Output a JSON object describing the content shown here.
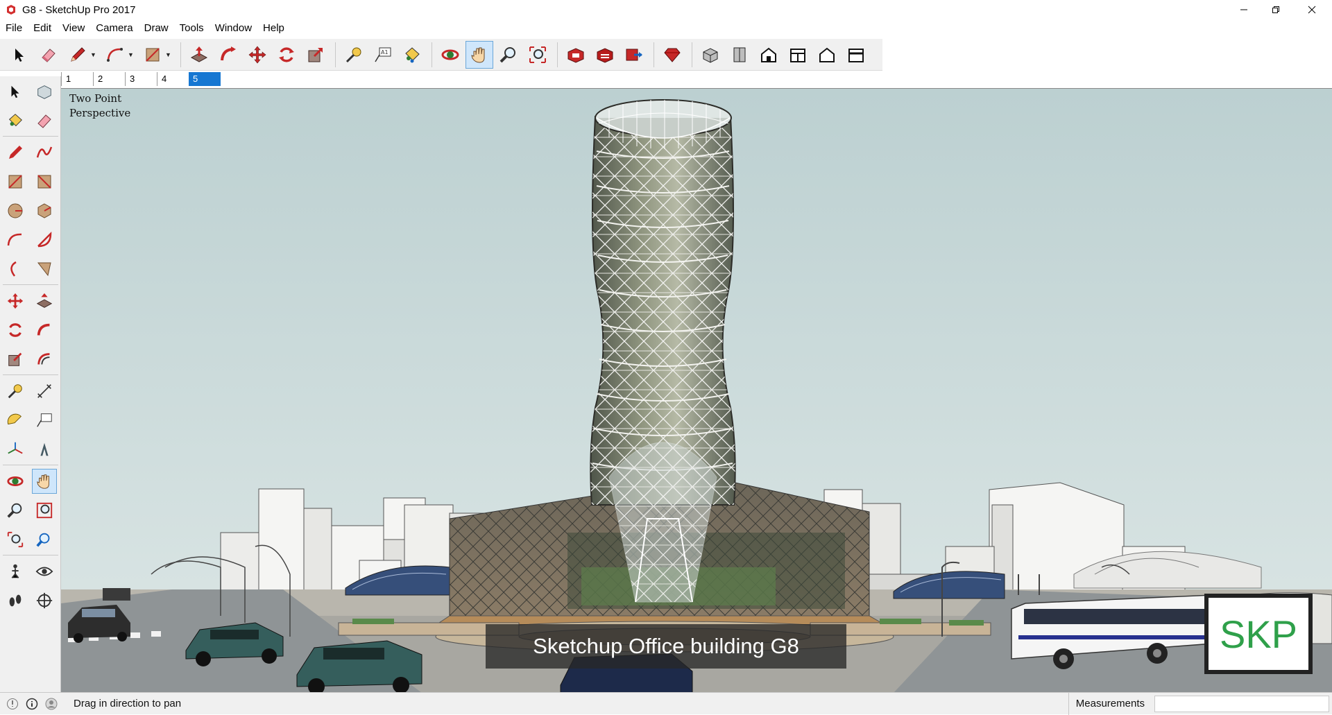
{
  "window": {
    "title": "G8 - SketchUp Pro 2017",
    "controls": [
      "minimize",
      "maximize",
      "close"
    ]
  },
  "menu": [
    "File",
    "Edit",
    "View",
    "Camera",
    "Draw",
    "Tools",
    "Window",
    "Help"
  ],
  "toolbar": {
    "active_tool": "pan",
    "groups": [
      [
        "select-icon",
        "eraser-icon",
        "pencil-icon",
        "arc-icon",
        "rectangle-icon"
      ],
      [
        "push-pull-icon",
        "follow-me-icon",
        "move-icon",
        "rotate-icon",
        "scale-icon"
      ],
      [
        "tape-measure-icon",
        "text-icon",
        "paint-bucket-icon"
      ],
      [
        "orbit-icon",
        "pan-icon",
        "zoom-icon",
        "zoom-extents-icon"
      ],
      [
        "3d-warehouse-icon",
        "extension-warehouse-icon",
        "send-to-layout-icon"
      ],
      [
        "ruby-icon"
      ],
      [
        "iso-view-icon",
        "top-view-icon",
        "front-view-icon",
        "right-view-icon",
        "back-view-icon",
        "left-view-icon"
      ]
    ]
  },
  "scenes": {
    "tabs": [
      "1",
      "2",
      "3",
      "4",
      "5"
    ],
    "active": "5"
  },
  "left_tools": [
    [
      "select-icon",
      "make-component-icon"
    ],
    [
      "paint-bucket-icon",
      "eraser-icon"
    ],
    [
      "line-icon",
      "freehand-icon"
    ],
    [
      "rectangle-icon",
      "rotated-rectangle-icon"
    ],
    [
      "circle-icon",
      "polygon-icon"
    ],
    [
      "arc-icon",
      "pie-icon"
    ],
    [
      "three-point-arc-icon",
      "two-point-arc-icon"
    ],
    [
      "move-icon",
      "push-pull-icon"
    ],
    [
      "rotate-icon",
      "follow-me-icon"
    ],
    [
      "scale-icon",
      "offset-icon"
    ],
    [
      "tape-measure-icon",
      "dimension-icon"
    ],
    [
      "protractor-icon",
      "text-icon"
    ],
    [
      "axes-icon",
      "3d-text-icon"
    ],
    [
      "orbit-icon",
      "pan-icon"
    ],
    [
      "zoom-icon",
      "zoom-window-icon"
    ],
    [
      "zoom-extents-icon",
      "previous-view-icon"
    ],
    [
      "position-camera-icon",
      "look-around-icon"
    ],
    [
      "walk-icon",
      "section-plane-icon"
    ]
  ],
  "viewport": {
    "camera_label": "Two Point\nPerspective",
    "caption": "Sketchup Office building G8",
    "logo_text": "SKP"
  },
  "status": {
    "message": "Drag in direction to pan",
    "measurements_label": "Measurements",
    "measurements_value": ""
  },
  "colors": {
    "sky": "#c9dadb",
    "ground": "#b9b6ad",
    "road": "#8f9496",
    "accent": "#1677d2",
    "logo_green": "#2fa04a"
  }
}
